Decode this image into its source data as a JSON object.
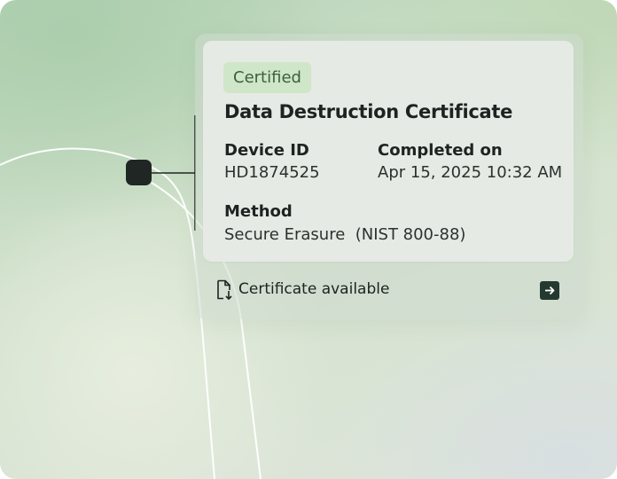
{
  "card": {
    "badge": "Certified",
    "title": "Data Destruction Certificate",
    "device_id_label": "Device ID",
    "device_id_value": "HD1874525",
    "completed_label": "Completed on",
    "completed_value": "Apr 15, 2025 10:32 AM",
    "method_label": "Method",
    "method_value": "Secure Erasure  (NIST 800-88)"
  },
  "footer": {
    "text": "Certificate available",
    "doc_icon": "document-download-icon",
    "arrow_icon": "arrow-right-icon"
  },
  "colors": {
    "badge_bg": "#cfe6c8",
    "badge_text": "#3c5f3a",
    "node": "#1f2623",
    "arrow_button": "#243a31"
  }
}
